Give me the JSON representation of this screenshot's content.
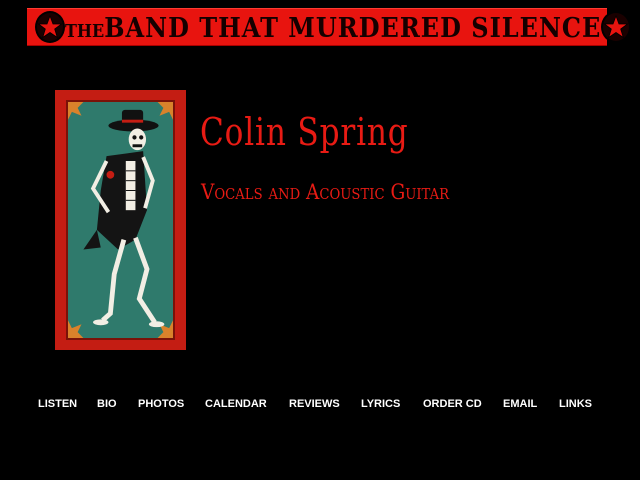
{
  "banner": {
    "prefix": "THE",
    "title": "BAND THAT MURDERED SILENCE",
    "left_emblem": "star-emblem-icon",
    "right_emblem": "star-emblem-icon"
  },
  "artwork": {
    "icon": "dancing-skeleton-illustration"
  },
  "member": {
    "name": "Colin Spring",
    "role": "Vocals and Acoustic Guitar"
  },
  "nav": {
    "items": [
      {
        "label": "LISTEN"
      },
      {
        "label": "BIO"
      },
      {
        "label": "PHOTOS"
      },
      {
        "label": "CALENDAR"
      },
      {
        "label": "REVIEWS"
      },
      {
        "label": "LYRICS"
      },
      {
        "label": "ORDER CD"
      },
      {
        "label": "EMAIL"
      },
      {
        "label": "LINKS"
      }
    ]
  },
  "colors": {
    "background": "#000000",
    "banner": "#e8140f",
    "accent_text": "#e81b14",
    "nav_text": "#ffffff",
    "art_bg": "#2f7a6c"
  }
}
